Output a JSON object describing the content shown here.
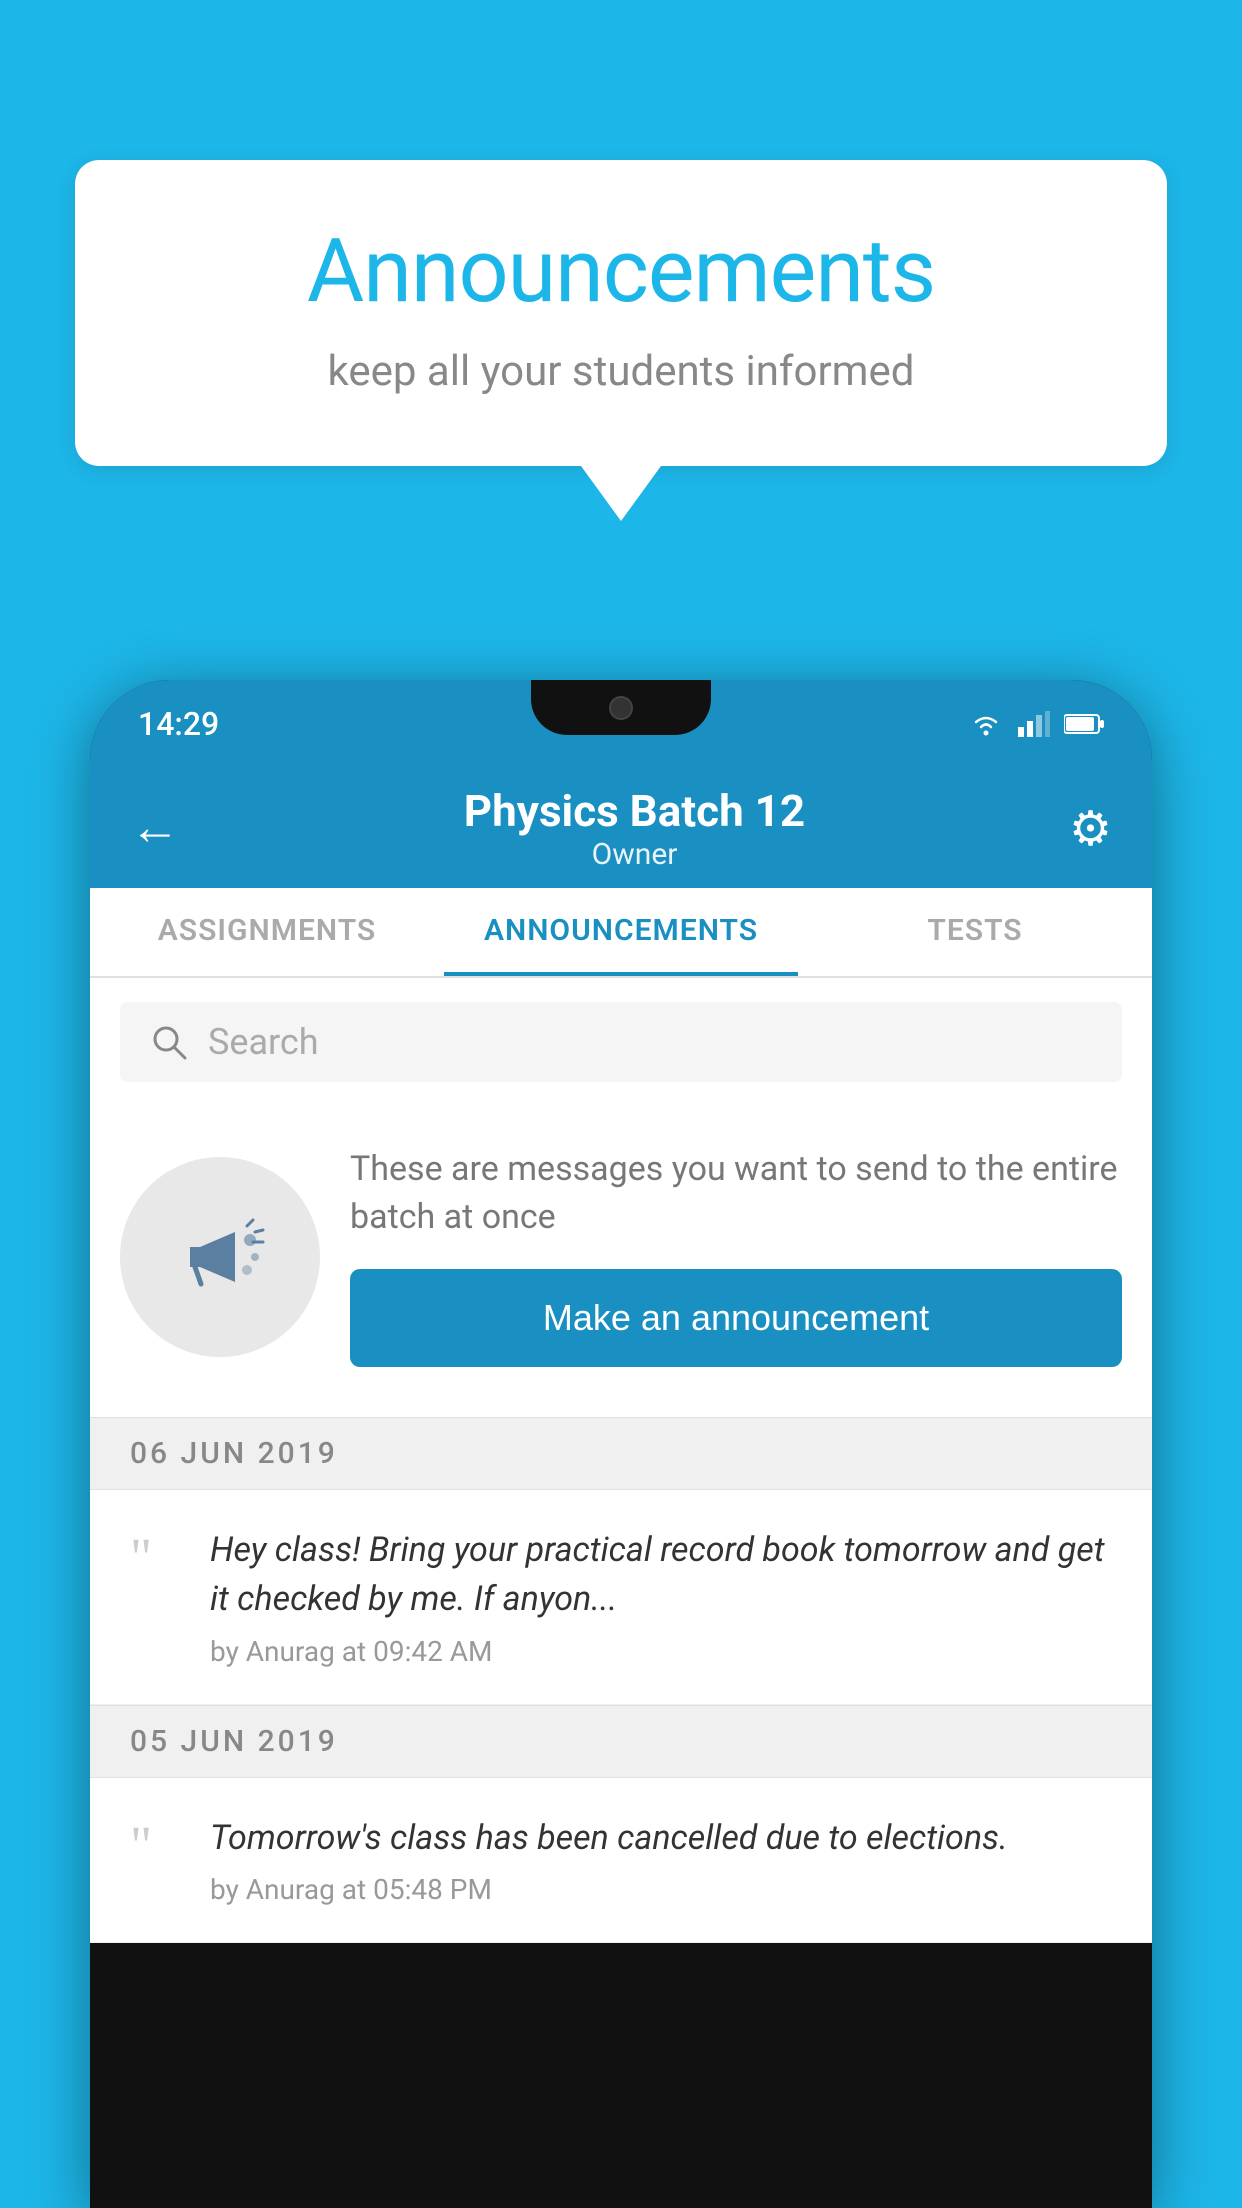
{
  "background_color": "#1DB6E8",
  "speech_bubble": {
    "title": "Announcements",
    "subtitle": "keep all your students informed"
  },
  "phone": {
    "status_bar": {
      "time": "14:29"
    },
    "app_bar": {
      "title": "Physics Batch 12",
      "subtitle": "Owner",
      "back_label": "←",
      "settings_label": "⚙"
    },
    "tabs": [
      {
        "label": "ASSIGNMENTS",
        "active": false
      },
      {
        "label": "ANNOUNCEMENTS",
        "active": true
      },
      {
        "label": "TESTS",
        "active": false
      }
    ],
    "search": {
      "placeholder": "Search"
    },
    "empty_state": {
      "description": "These are messages you want to send to the entire batch at once",
      "button_label": "Make an announcement"
    },
    "date_sections": [
      {
        "date": "06  JUN  2019",
        "messages": [
          {
            "text": "Hey class! Bring your practical record book tomorrow and get it checked by me. If anyon...",
            "meta": "by Anurag at 09:42 AM"
          }
        ]
      },
      {
        "date": "05  JUN  2019",
        "messages": [
          {
            "text": "Tomorrow's class has been cancelled due to elections.",
            "meta": "by Anurag at 05:48 PM"
          }
        ]
      }
    ]
  }
}
